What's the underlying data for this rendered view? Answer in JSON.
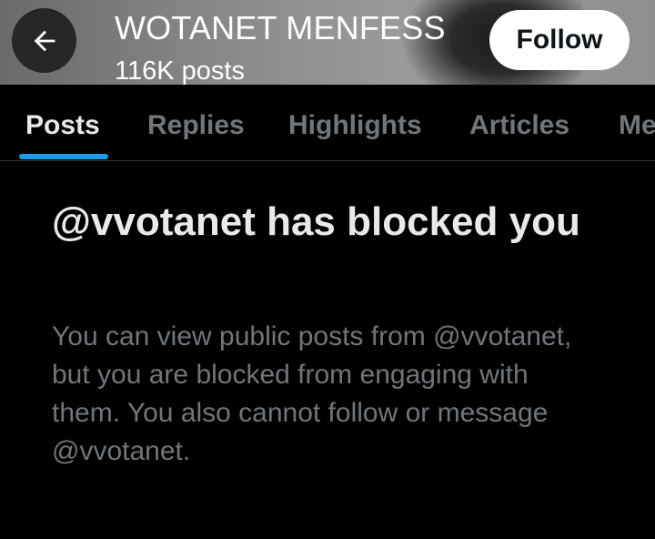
{
  "header": {
    "back_icon": "arrow-left-icon",
    "name": "WOTANET MENFESS",
    "post_count": "116K posts",
    "follow_label": "Follow"
  },
  "tabs": [
    {
      "label": "Posts",
      "active": true
    },
    {
      "label": "Replies",
      "active": false
    },
    {
      "label": "Highlights",
      "active": false
    },
    {
      "label": "Articles",
      "active": false
    },
    {
      "label": "Me",
      "active": false
    }
  ],
  "blocked": {
    "title": "@vvotanet has blocked you",
    "body": "You can view public posts from @vvotanet, but you are blocked from engaging with them. You also cannot follow or message @vvotanet."
  },
  "colors": {
    "background": "#000000",
    "accent": "#1d9bf0",
    "primary_text": "#e7e9ea",
    "secondary_text": "#71767b"
  }
}
